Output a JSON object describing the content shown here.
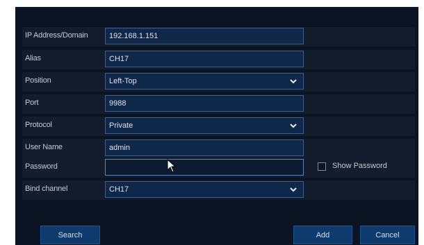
{
  "form": {
    "rows": [
      {
        "label": "IP Address/Domain",
        "value": "192.168.1.151",
        "type": "text"
      },
      {
        "label": "Alias",
        "value": "CH17",
        "type": "text"
      },
      {
        "label": "Position",
        "value": "Left-Top",
        "type": "select"
      },
      {
        "label": "Port",
        "value": "9988",
        "type": "text"
      },
      {
        "label": "Protocol",
        "value": "Private",
        "type": "select"
      },
      {
        "label": "User Name",
        "value": "admin",
        "type": "text"
      },
      {
        "label": "Password",
        "value": "",
        "type": "password"
      },
      {
        "label": "Bind channel",
        "value": "CH17",
        "type": "select"
      }
    ],
    "show_password_label": "Show Password",
    "show_password_checked": false
  },
  "buttons": {
    "search": "Search",
    "add": "Add",
    "cancel": "Cancel"
  },
  "icons": {
    "dropdown": "chevron-down-icon",
    "cursor": "mouse-pointer-icon",
    "checkbox": "checkbox-icon"
  },
  "colors": {
    "background": "#0b1422",
    "field": "#0f2748",
    "field_border": "#3c5f8c",
    "button": "#0f3a6d",
    "text": "#c4cad6"
  }
}
